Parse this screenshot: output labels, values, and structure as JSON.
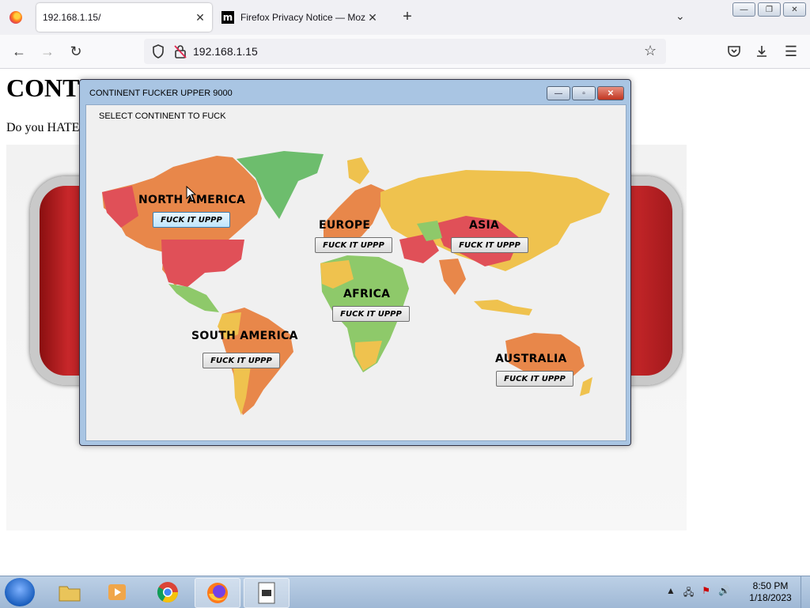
{
  "browser": {
    "tabs": [
      {
        "title": "192.168.1.15/",
        "active": true
      },
      {
        "title": "Firefox Privacy Notice — Mozilla",
        "active": false
      }
    ],
    "url": "192.168.1.15"
  },
  "page": {
    "heading": "CONT",
    "text": "Do you HATE"
  },
  "dialog": {
    "title": "CONTINENT FUCKER UPPER 9000",
    "select_label": "SELECT CONTINENT TO FUCK",
    "continents": [
      {
        "id": "na",
        "name": "NORTH AMERICA",
        "button": "FUCK IT UPPP"
      },
      {
        "id": "eu",
        "name": "EUROPE",
        "button": "FUCK IT UPPP"
      },
      {
        "id": "as",
        "name": "ASIA",
        "button": "FUCK IT UPPP"
      },
      {
        "id": "af",
        "name": "AFRICA",
        "button": "FUCK IT UPPP"
      },
      {
        "id": "sa",
        "name": "SOUTH AMERICA",
        "button": "FUCK IT UPPP"
      },
      {
        "id": "au",
        "name": "AUSTRALIA",
        "button": "FUCK IT UPPP"
      }
    ]
  },
  "taskbar": {
    "time": "8:50 PM",
    "date": "1/18/2023"
  },
  "colors": {
    "map_red": "#e05058",
    "map_orange": "#e8874a",
    "map_yellow": "#efc24e",
    "map_green": "#8ec96a",
    "map_greenland": "#6dbd6d"
  }
}
